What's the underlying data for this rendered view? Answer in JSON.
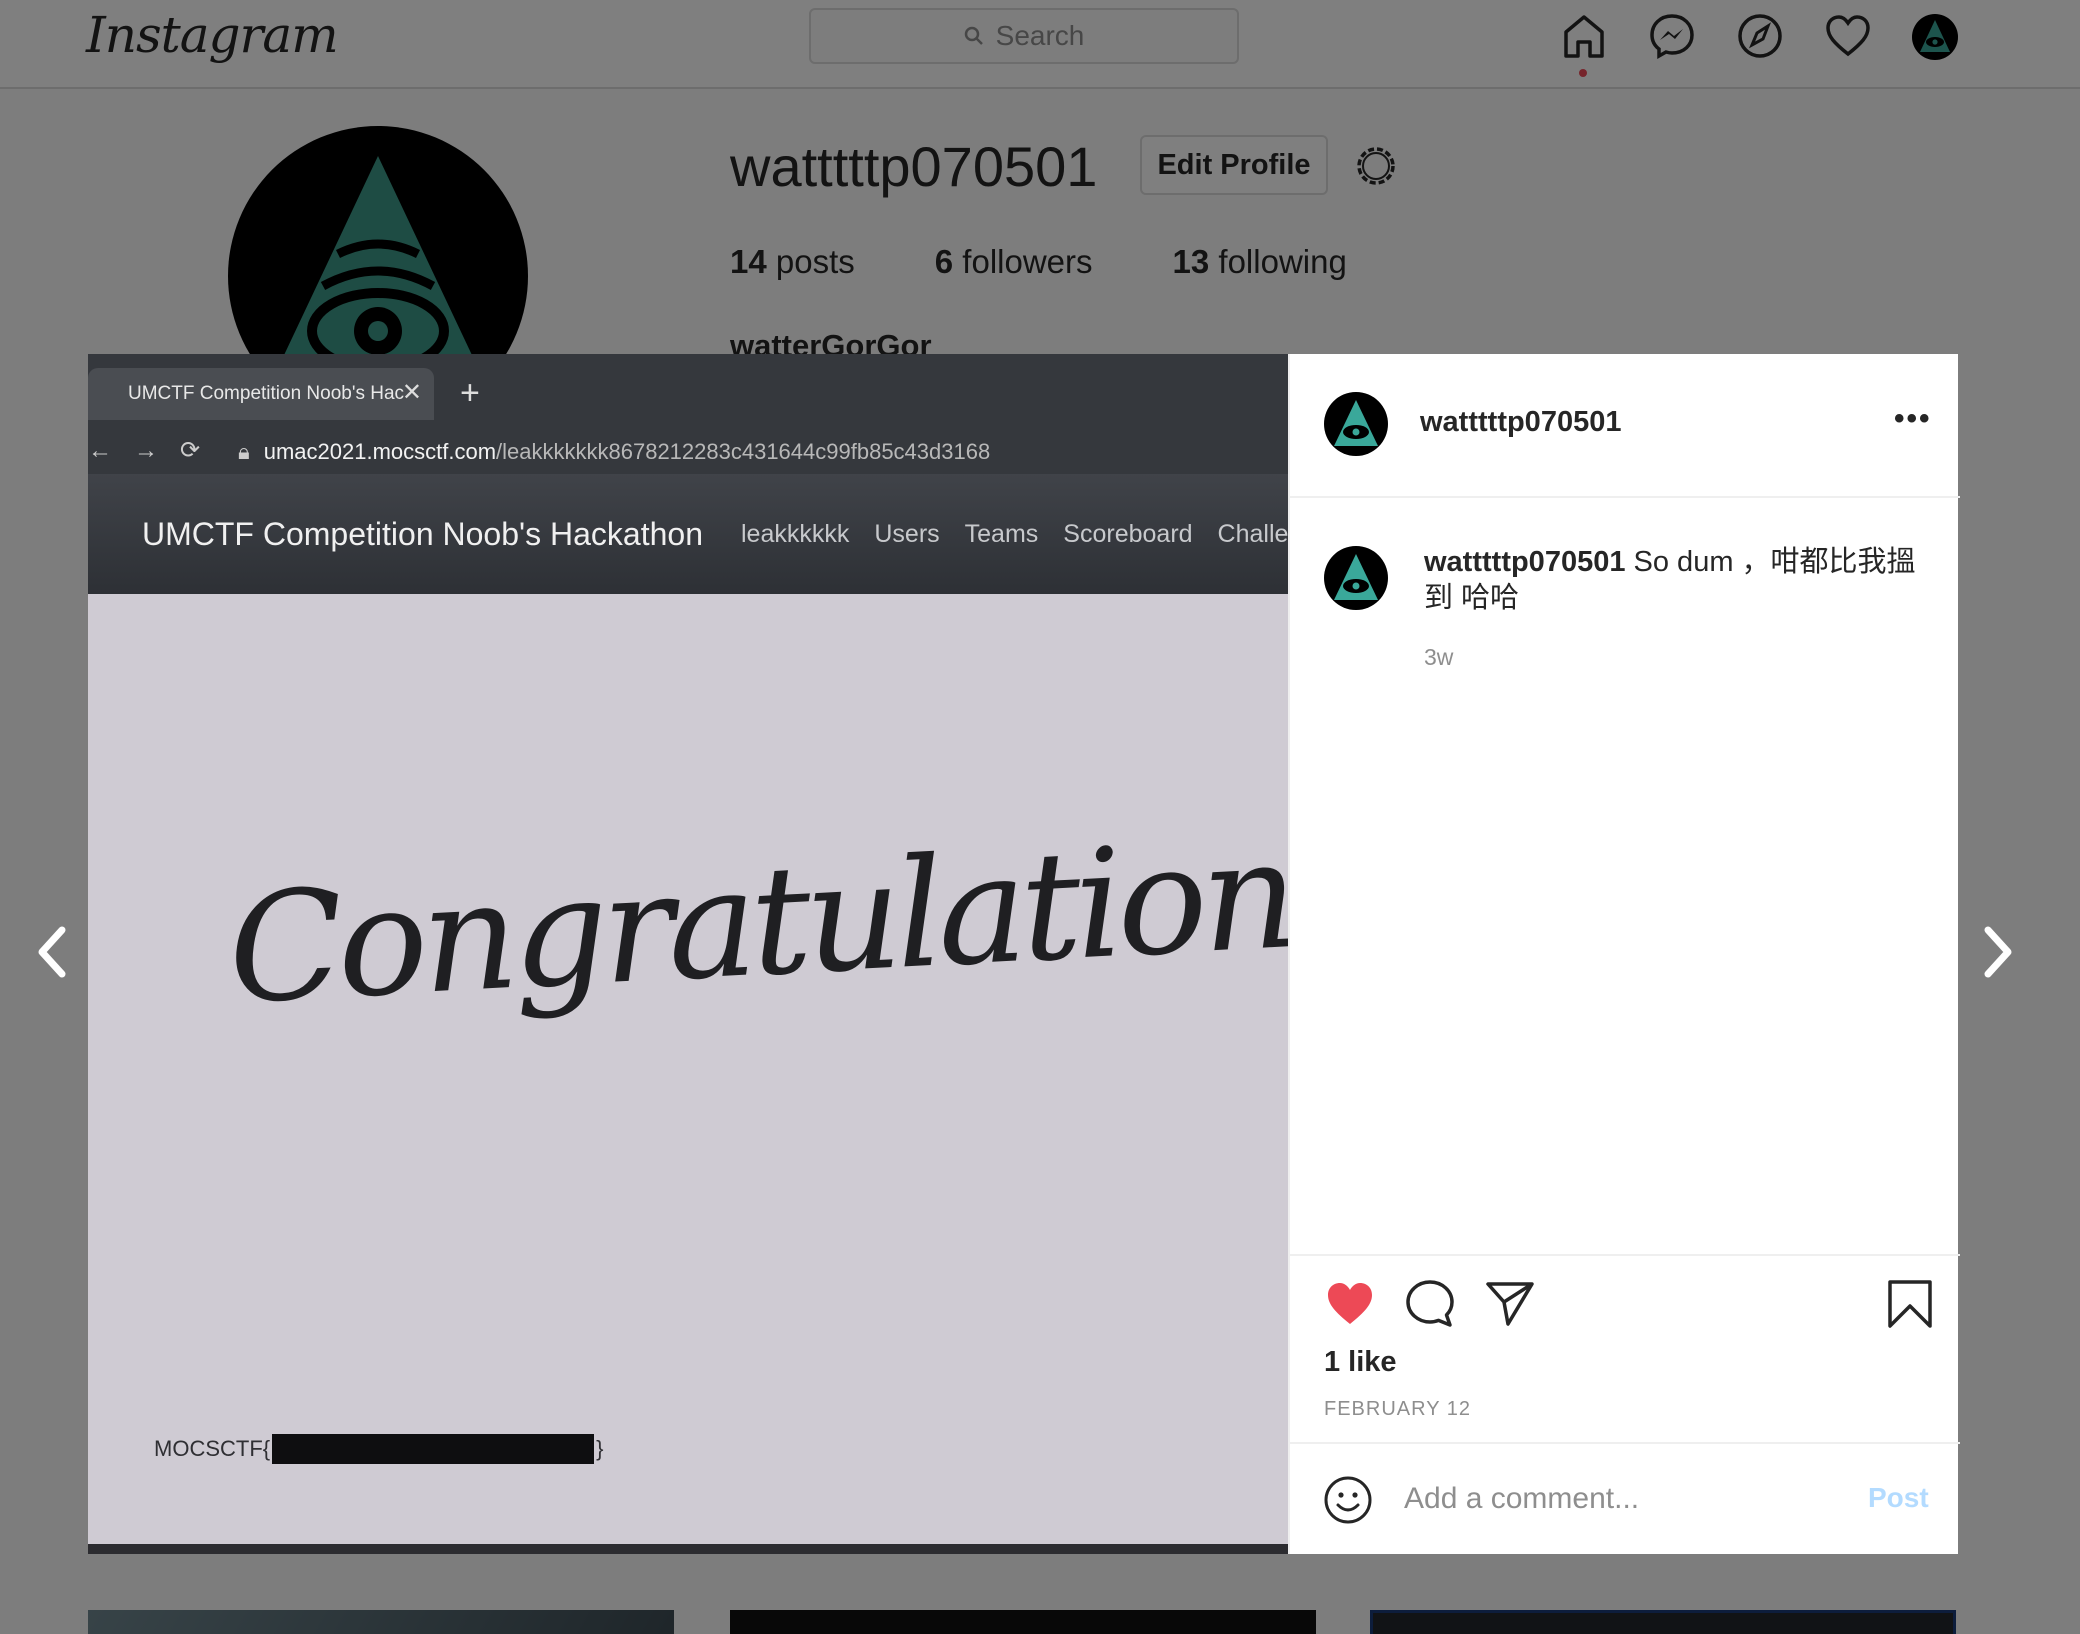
{
  "header": {
    "logo": "Instagram",
    "search_placeholder": "Search",
    "nav": [
      "home-icon",
      "messenger-icon",
      "explore-icon",
      "activity-icon",
      "profile-avatar"
    ]
  },
  "profile": {
    "username": "watttttp070501",
    "edit_button": "Edit Profile",
    "posts_count": "14",
    "posts_label": "posts",
    "followers_count": "6",
    "followers_label": "followers",
    "following_count": "13",
    "following_label": "following",
    "full_name": "watterGorGor"
  },
  "post": {
    "photo": {
      "tab_title": "UMCTF Competition Noob's Hac",
      "url_host": "umac2021.mocsctf.com",
      "url_path": "/leakkkkkkk8678212283c431644c99fb85c43d3168",
      "site_brand": "UMCTF Competition Noob's Hackathon",
      "site_nav": [
        "leakkkkkk",
        "Users",
        "Teams",
        "Scoreboard",
        "Challenge"
      ],
      "headline": "Congratulations",
      "flag_prefix": "MOCSCTF{",
      "flag_suffix": "}"
    },
    "author": "watttttp070501",
    "caption_user": "watttttp070501",
    "caption_text": "So dum ，咁都比我搵到 哈哈",
    "time_ago": "3w",
    "likes": "1 like",
    "date": "FEBRUARY 12",
    "comment_placeholder": "Add a comment...",
    "post_button": "Post",
    "colors": {
      "like": "#ed4956",
      "post_button": "#b3dbff"
    }
  }
}
